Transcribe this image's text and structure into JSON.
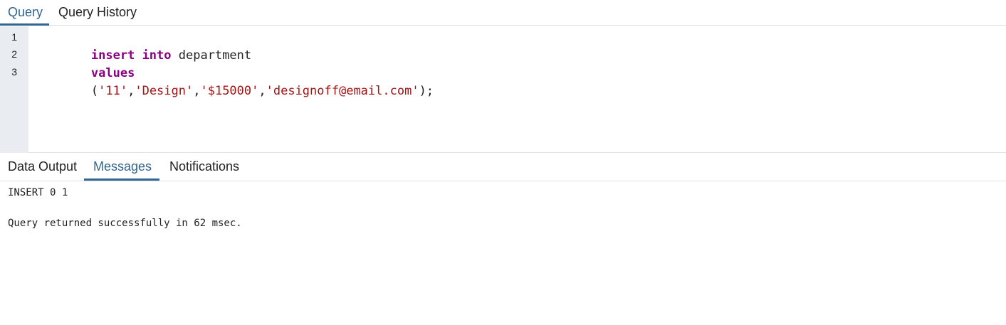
{
  "top_tabs": [
    {
      "label": "Query",
      "active": true
    },
    {
      "label": "Query History",
      "active": false
    }
  ],
  "editor": {
    "line_numbers": [
      "1",
      "2",
      "3"
    ],
    "lines": [
      {
        "tokens": [
          {
            "text": "insert",
            "type": "keyword"
          },
          {
            "text": " ",
            "type": "space"
          },
          {
            "text": "into",
            "type": "keyword"
          },
          {
            "text": " department",
            "type": "identifier"
          }
        ]
      },
      {
        "tokens": [
          {
            "text": "values",
            "type": "keyword"
          }
        ]
      },
      {
        "tokens": [
          {
            "text": "(",
            "type": "punct"
          },
          {
            "text": "'11'",
            "type": "string"
          },
          {
            "text": ",",
            "type": "punct"
          },
          {
            "text": "'Design'",
            "type": "string"
          },
          {
            "text": ",",
            "type": "punct"
          },
          {
            "text": "'$15000'",
            "type": "string"
          },
          {
            "text": ",",
            "type": "punct"
          },
          {
            "text": "'designoff@email.com'",
            "type": "string"
          },
          {
            "text": ");",
            "type": "punct"
          }
        ]
      }
    ]
  },
  "bottom_tabs": [
    {
      "label": "Data Output",
      "active": false
    },
    {
      "label": "Messages",
      "active": true
    },
    {
      "label": "Notifications",
      "active": false
    }
  ],
  "messages": {
    "line1": "INSERT 0 1",
    "line2": "Query returned successfully in 62 msec."
  },
  "colors": {
    "accent": "#326690",
    "keyword": "#8b0083",
    "string": "#a31515",
    "gutter": "#e9edf2",
    "border": "#dde0e6"
  }
}
